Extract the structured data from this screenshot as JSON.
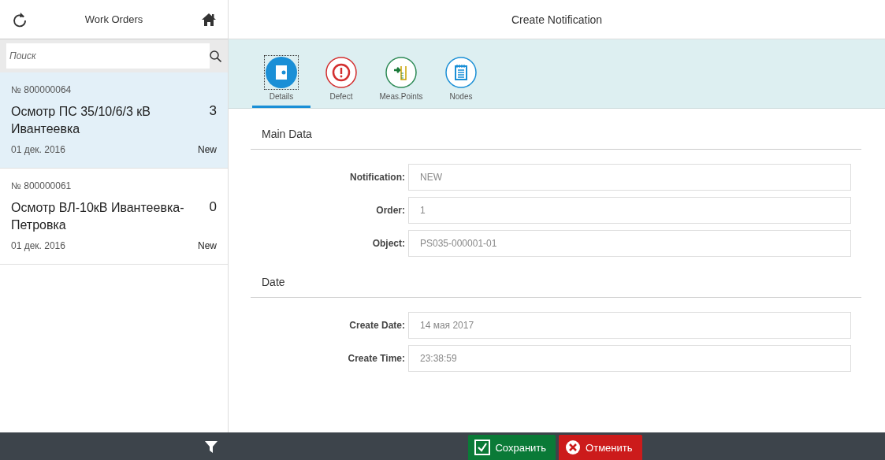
{
  "master": {
    "title": "Work Orders",
    "search": {
      "placeholder": "Поиск"
    },
    "items": [
      {
        "number": "№ 800000064",
        "title": "Осмотр ПС 35/10/6/3 кВ Ивантеевка",
        "count": "3",
        "date": "01 дек. 2016",
        "status": "New",
        "selected": true
      },
      {
        "number": "№ 800000061",
        "title": "Осмотр ВЛ-10кВ Ивантеевка-Петровка",
        "count": "0",
        "date": "01 дек. 2016",
        "status": "New",
        "selected": false
      }
    ]
  },
  "detail": {
    "title": "Create Notification",
    "tabs": [
      {
        "kind": "details",
        "label": "Details",
        "selected": true
      },
      {
        "kind": "defect",
        "label": "Defect",
        "selected": false
      },
      {
        "kind": "meas",
        "label": "Meas.Points",
        "selected": false
      },
      {
        "kind": "nodes",
        "label": "Nodes",
        "selected": false
      }
    ],
    "sections": [
      {
        "title": "Main Data",
        "fields": [
          {
            "label": "Notification:",
            "value": "NEW"
          },
          {
            "label": "Order:",
            "value": "1"
          },
          {
            "label": "Object:",
            "value": "PS035-000001-01"
          }
        ]
      },
      {
        "title": "Date",
        "fields": [
          {
            "label": "Create Date:",
            "value": "14 мая 2017"
          },
          {
            "label": "Create Time:",
            "value": "23:38:59"
          }
        ]
      }
    ]
  },
  "footer": {
    "buttons": [
      {
        "kind": "save",
        "label": "Сохранить"
      },
      {
        "kind": "cancel",
        "label": "Отменить"
      }
    ]
  }
}
